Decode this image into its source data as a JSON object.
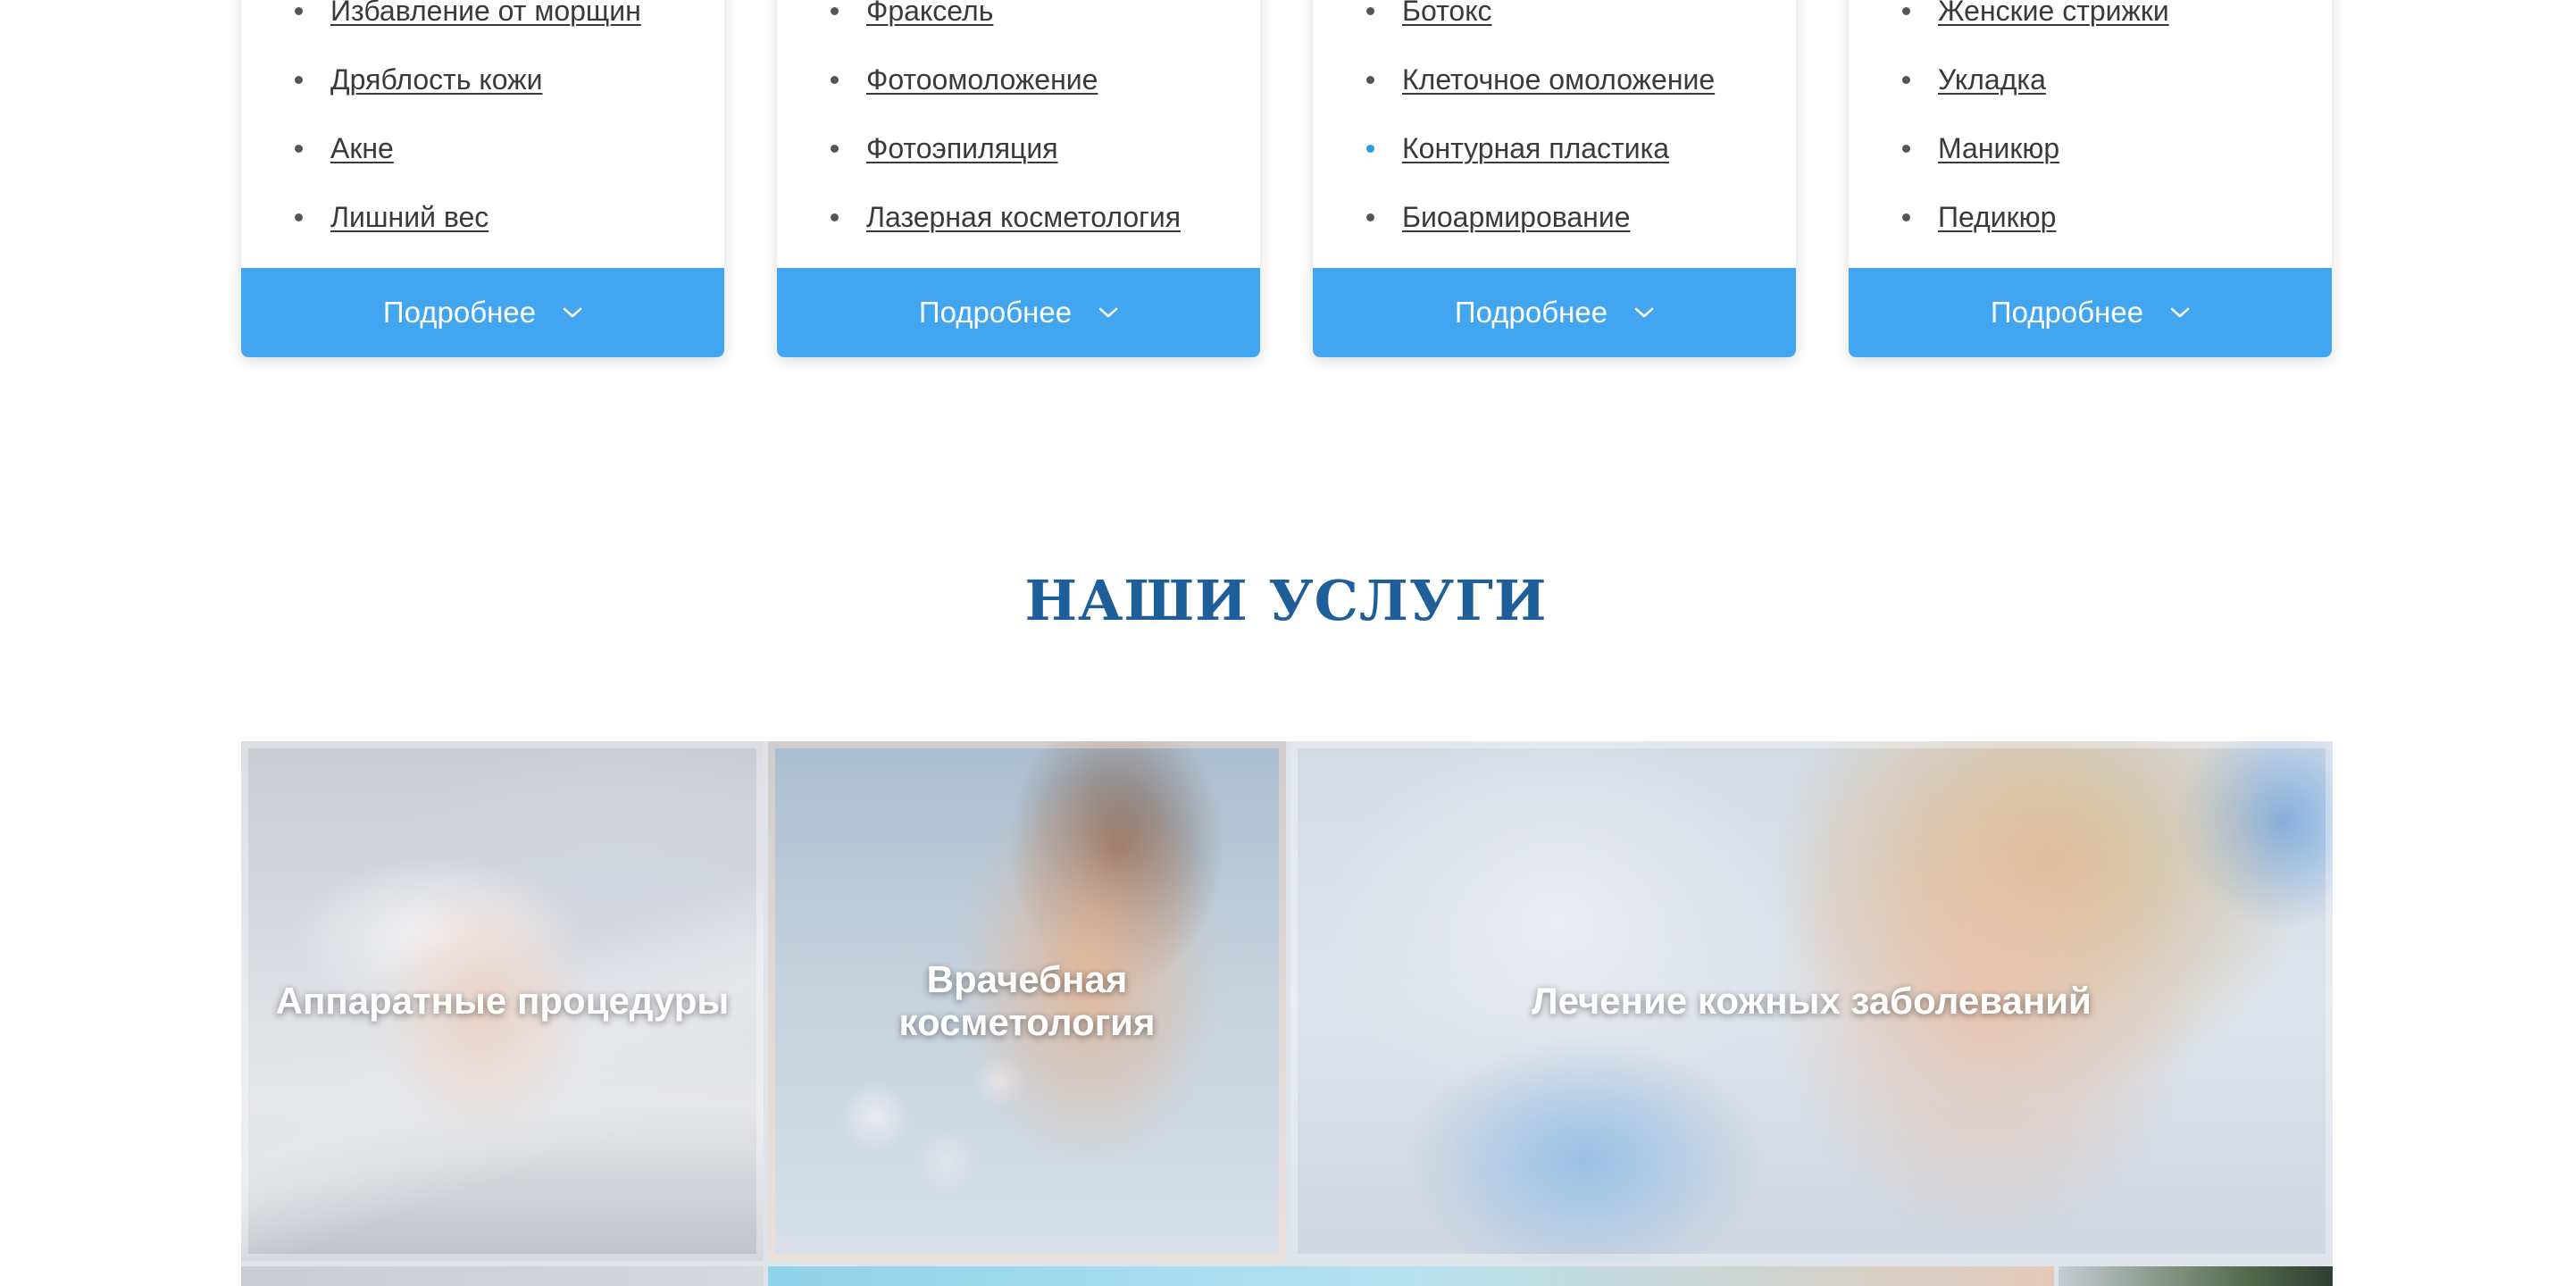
{
  "cards": [
    {
      "items": [
        "Избавление от морщин",
        "Дряблость кожи",
        "Акне",
        "Лишний вес"
      ],
      "button_label": "Подробнее"
    },
    {
      "items": [
        "Фраксель",
        "Фотоомоложение",
        "Фотоэпиляция",
        "Лазерная косметология"
      ],
      "button_label": "Подробнее"
    },
    {
      "items": [
        "Ботокс",
        "Клеточное омоложение",
        "Контурная пластика",
        "Биоармирование"
      ],
      "button_label": "Подробнее"
    },
    {
      "items": [
        "Женские стрижки",
        "Укладка",
        "Маникюр",
        "Педикюр"
      ],
      "button_label": "Подробнее"
    }
  ],
  "services": {
    "title": "НАШИ УСЛУГИ",
    "tiles": [
      {
        "label": "Аппаратные процедуры"
      },
      {
        "label_line1": "Врачебная",
        "label_line2": "косметология"
      },
      {
        "label": "Лечение кожных заболеваний"
      }
    ]
  },
  "colors": {
    "button": "#42a5f0",
    "title": "#1f5f99",
    "bullet_accent": "#2f9be0"
  },
  "icons": {
    "button_icon": "chevron-down-icon"
  }
}
